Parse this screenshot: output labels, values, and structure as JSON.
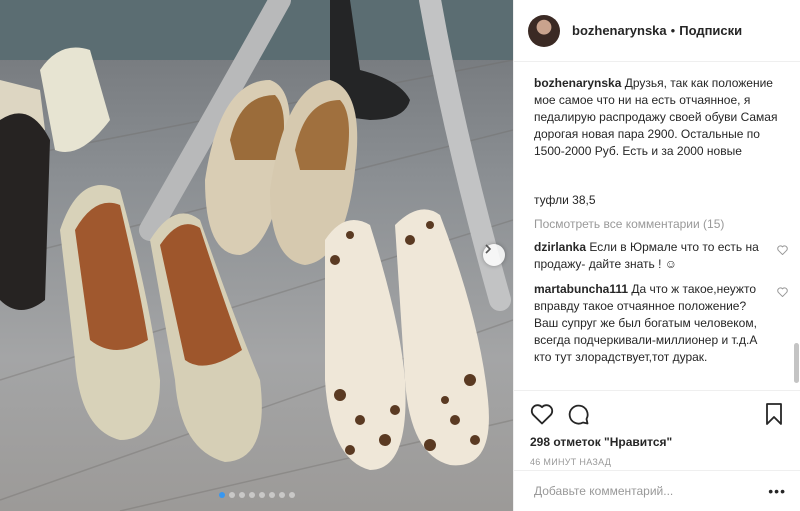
{
  "post": {
    "username": "bozhenarynska",
    "separator": "•",
    "follow_label": "Подписки",
    "caption_text": "Друзья, так как положение мое самое что ни на есть отчаянное, я педалирую распродажу своей обуви                  Самая дорогая новая пара 2900. Остальные по 1500-2000 Руб. Есть         и за 2000 новые",
    "caption_extra": "туфли 38,5",
    "view_all_comments": "Посмотреть все комментарии (15)",
    "comments": [
      {
        "user": "dzirlanka",
        "text": "Если в Юрмале что то есть на продажу- дайте знать ! ☺"
      },
      {
        "user": "martabuncha111",
        "text": "Да что ж такое,неужто вправду такое отчаянное положение?Ваш супруг же был богатым человеком, всегда подчеркивали-миллионер и т.д.А кто тут злорадствует,тот дурак."
      }
    ],
    "likes": "298 отметок \"Нравится\"",
    "time": "46 МИНУТ НАЗАД",
    "comment_placeholder": "Добавьте комментарий...",
    "more_label": "•••"
  },
  "carousel": {
    "count": 8,
    "active": 0
  },
  "icons": {
    "heart": "heart-icon",
    "comment": "comment-icon",
    "bookmark": "bookmark-icon",
    "next": "chevron-right-icon"
  },
  "colors": {
    "accent": "#3897f0",
    "muted": "#999999",
    "text": "#262626"
  }
}
